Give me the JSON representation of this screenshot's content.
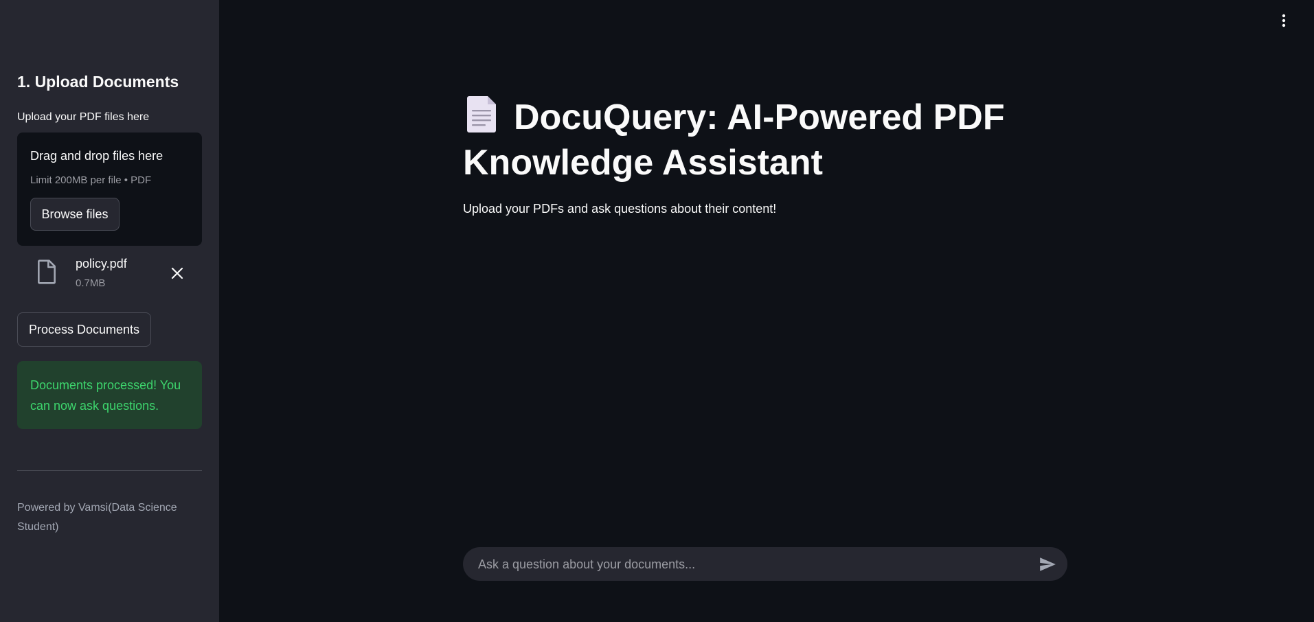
{
  "sidebar": {
    "section_title": "1. Upload Documents",
    "upload_label": "Upload your PDF files here",
    "dropzone": {
      "title": "Drag and drop files here",
      "limit": "Limit 200MB per file • PDF",
      "browse_label": "Browse files"
    },
    "file": {
      "name": "policy.pdf",
      "size": "0.7MB",
      "icon": "file-icon"
    },
    "process_label": "Process Documents",
    "success_message": "Documents processed! You can now ask questions.",
    "footer": "Powered by Vamsi(Data Science Student)"
  },
  "main": {
    "title": "DocuQuery: AI-Powered PDF Knowledge Assistant",
    "title_icon": "page-document-icon",
    "subtitle": "Upload your PDFs and ask questions about their content!",
    "chat": {
      "placeholder": "Ask a question about your documents..."
    }
  },
  "colors": {
    "background": "#0e1117",
    "sidebar": "#262730",
    "success_bg": "#21412d",
    "success_text": "#3dd56d"
  }
}
